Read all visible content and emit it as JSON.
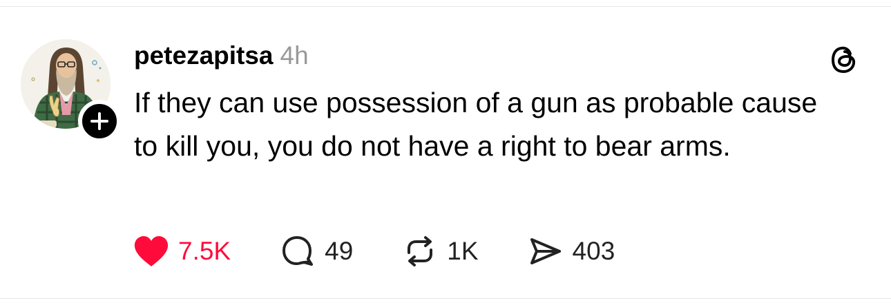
{
  "post": {
    "username": "petezapitsa",
    "timestamp": "4h",
    "text": "If they can use possession of a gun as probable cause to kill you, you do not have a right to bear arms."
  },
  "actions": {
    "likes": "7.5K",
    "replies": "49",
    "reposts": "1K",
    "shares": "403"
  },
  "colors": {
    "like_red": "#ff0b3b",
    "timestamp_gray": "#999999"
  },
  "icons": {
    "like": "heart-filled-icon",
    "reply": "speech-bubble-icon",
    "repost": "repost-arrows-icon",
    "share": "paper-plane-icon",
    "brand": "threads-logo-icon",
    "follow": "plus-icon"
  }
}
